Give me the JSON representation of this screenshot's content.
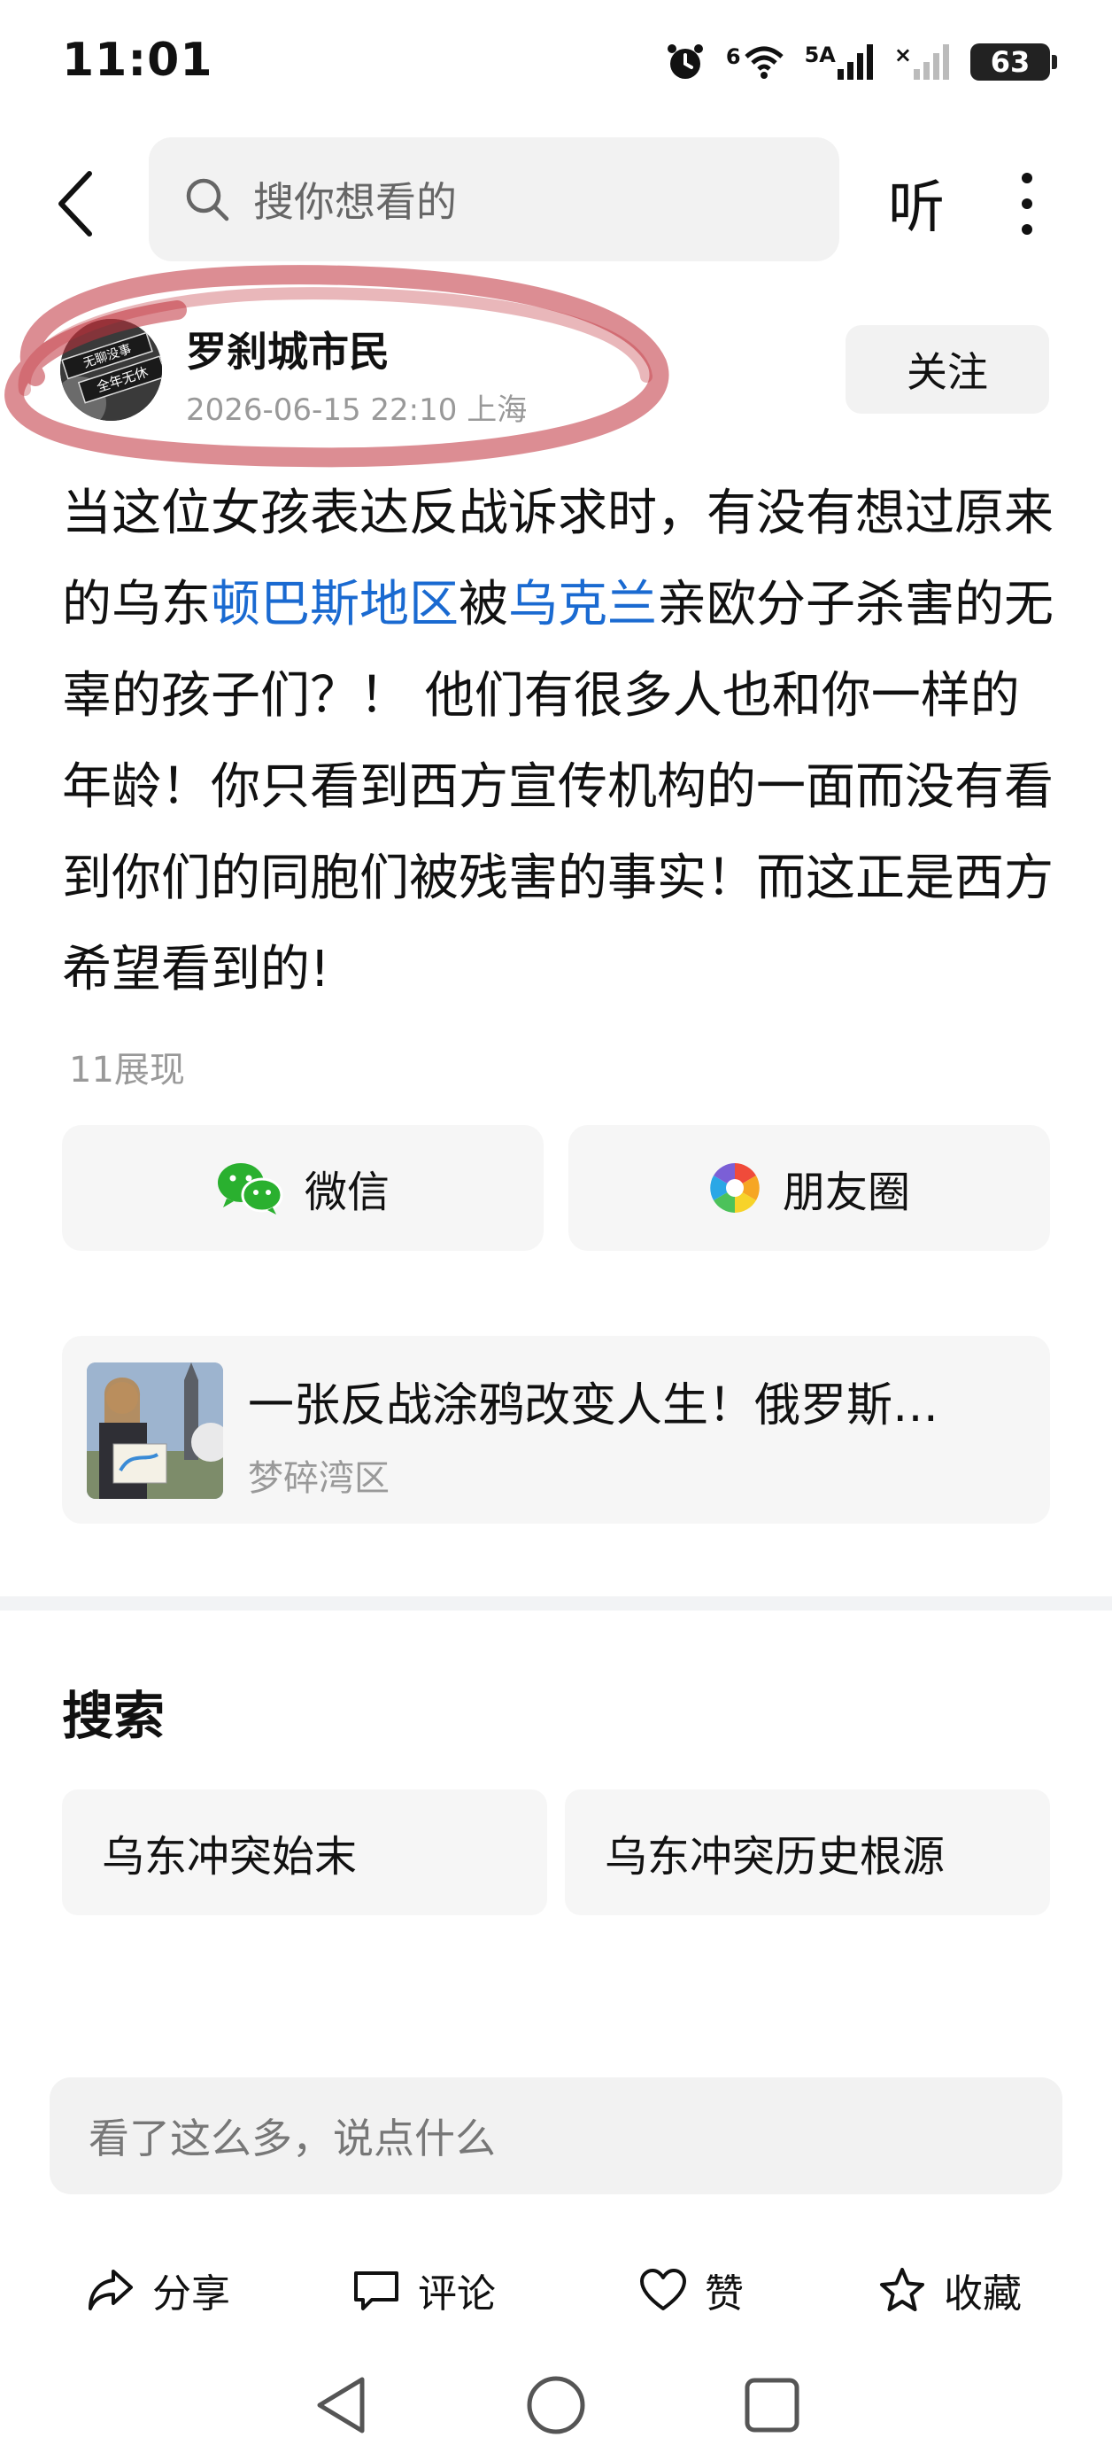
{
  "status_bar": {
    "time": "11:01",
    "network_label": "6",
    "signal1_label": "5A",
    "signal2_label": "×",
    "battery": "63"
  },
  "top_bar": {
    "search_placeholder": "搜你想看的",
    "listen_label": "听"
  },
  "author": {
    "name": "罗刹城市民",
    "meta": "2026-06-15 22:10 上海",
    "avatar_text_1": "无聊没事",
    "avatar_text_2": "全年无休",
    "follow_label": "关注"
  },
  "post": {
    "seg1": "当这位女孩表达反战诉求时，有没有想过原来的乌东",
    "link1": "顿巴斯地区",
    "seg2": "被",
    "link2": "乌克兰",
    "seg3": "亲欧分子杀害的无辜的孩子们？！ 他们有很多人也和你一样的年龄！你只看到西方宣传机构的一面而没有看到你们的同胞们被残害的事实！而这正是西方希望看到的!",
    "views": "11展现"
  },
  "share": {
    "wechat_label": "微信",
    "moments_label": "朋友圈"
  },
  "related": {
    "title": "一张反战涂鸦改变人生！俄罗斯…",
    "source": "梦碎湾区"
  },
  "search_section": {
    "title": "搜索",
    "suggestions": [
      "乌东冲突始末",
      "乌东冲突历史根源"
    ]
  },
  "comment": {
    "placeholder": "看了这么多，说点什么"
  },
  "actions": {
    "share_label": "分享",
    "comment_label": "评论",
    "like_label": "赞",
    "favorite_label": "收藏"
  },
  "colors": {
    "link": "#1a6ad1",
    "highlight_ring": "#c0303a",
    "wechat_green": "#2ab02f"
  }
}
